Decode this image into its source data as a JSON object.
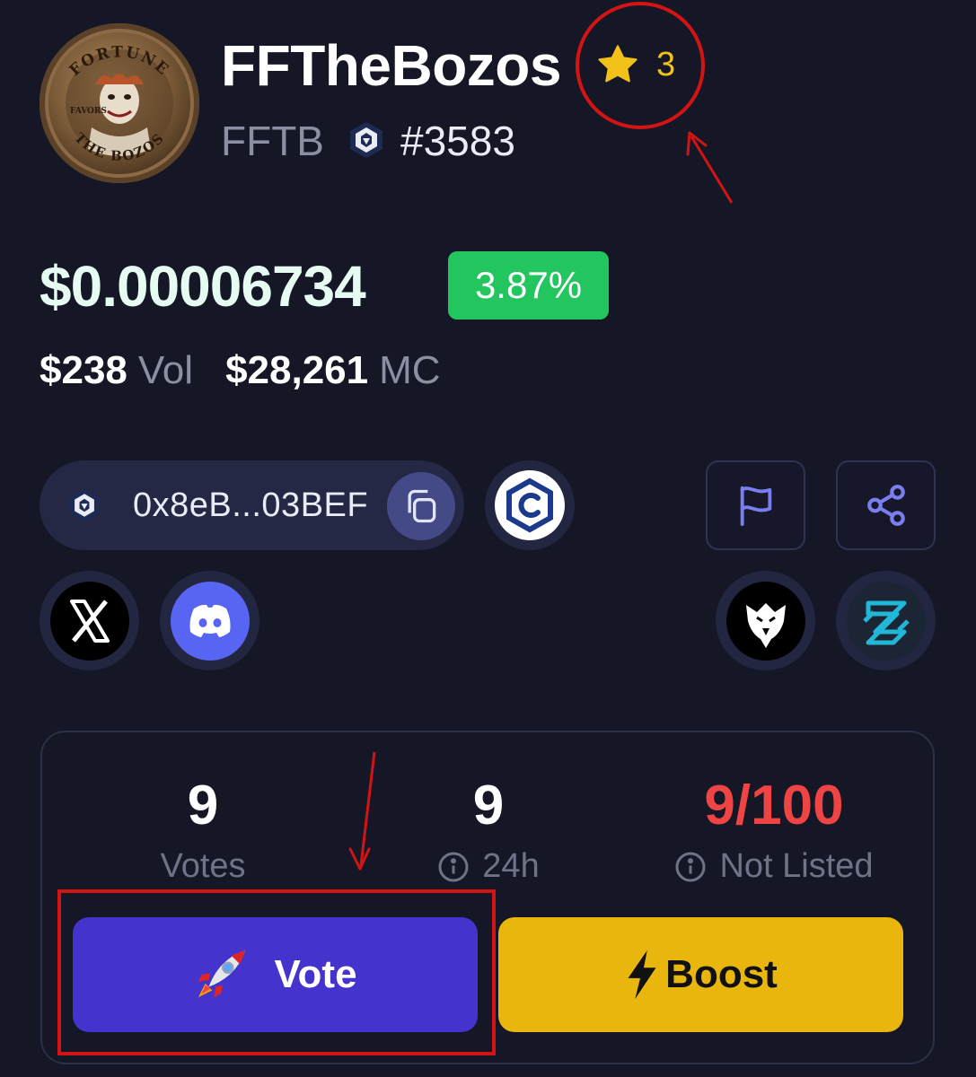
{
  "token": {
    "name": "FFTheBozos",
    "symbol": "FFTB",
    "rank": "#3583",
    "favorites": "3",
    "logo_text": [
      "FORTUNE",
      "FAVORS",
      "THE BOZOS"
    ]
  },
  "price": {
    "value": "$0.00006734",
    "change": "3.87%",
    "volume_value": "$238",
    "volume_label": "Vol",
    "mcap_value": "$28,261",
    "mcap_label": "MC"
  },
  "contract": {
    "address": "0x8eB...03BEF"
  },
  "links": {
    "explorer_icon": "cronos-explorer-icon",
    "twitter_icon": "x-icon",
    "discord_icon": "discord-icon",
    "report_icon": "flag-icon",
    "share_icon": "share-icon",
    "eagle_icon": "eagle-icon",
    "dex_icon": "dex-screener-icon"
  },
  "stats": {
    "votes_value": "9",
    "votes_label": "Votes",
    "day_value": "9",
    "day_label": "24h",
    "listing_value": "9/100",
    "listing_label": "Not Listed"
  },
  "actions": {
    "vote_label": "Vote",
    "boost_label": "Boost"
  },
  "colors": {
    "background": "#151726",
    "change_positive": "#22c55e",
    "vote_button": "#4433cc",
    "boost_button": "#e8b60c",
    "listing_value": "#ef4444",
    "star": "#f3c21a",
    "annotation": "#d21414"
  }
}
